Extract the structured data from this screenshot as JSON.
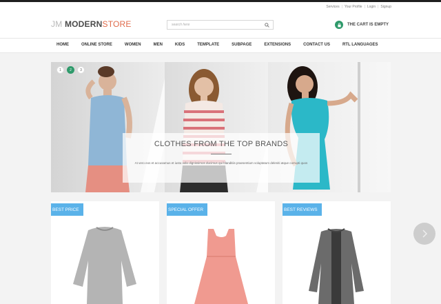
{
  "header": {
    "top_links": [
      "Services",
      "Your Profile",
      "Login",
      "Signup"
    ],
    "logo": {
      "part1": "JM",
      "part2": "MODERN",
      "part3": "STORE"
    },
    "search_placeholder": "search here",
    "cart_label": "THE CART IS EMPTY"
  },
  "nav": {
    "items": [
      "HOME",
      "ONLINE STORE",
      "WOMEN",
      "MEN",
      "KIDS",
      "TEMPLATE",
      "SUBPAGE",
      "EXTENSIONS",
      "CONTACT US",
      "RTL LANGUAGES"
    ]
  },
  "slider": {
    "dots": [
      "1",
      "2",
      "3"
    ],
    "active_dot": 2,
    "caption_title": "CLOTHES FROM THE TOP BRANDS",
    "caption_text": "At vero eos et accusamus et iusto odio dignissimos ducimus qui blanditiis praesentium voluptatum deleniti atque corrupti quos"
  },
  "cards": [
    {
      "badge": "BEST PRICE"
    },
    {
      "badge": "SPECIAL OFFER"
    },
    {
      "badge": "BEST REVIEWS"
    }
  ],
  "colors": {
    "accent_green": "#2f9a6b",
    "badge_blue": "#5ab2e9",
    "logo_orange": "#e06b4b"
  }
}
